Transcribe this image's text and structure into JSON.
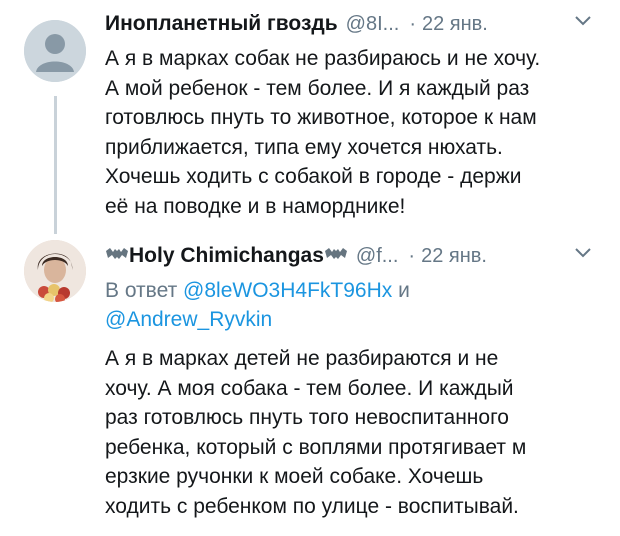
{
  "tweet1": {
    "author_name": "Инопланетный гвоздь",
    "handle": "@8I...",
    "dot": "·",
    "date": "22 янв.",
    "lines": [
      "А я в марках собак не разбираюсь и не хочу.",
      "А мой ребенок - тем более. И я каждый раз",
      "готовлюсь пнуть то животное, которое к нам",
      "приближается, типа ему хочется нюхать.",
      "Хочешь ходить с собакой в городе - держи",
      "её на поводке и в наморднике!"
    ]
  },
  "tweet2": {
    "author_name": "Holy Chimichangas",
    "handle": "@f...",
    "dot": "·",
    "date": "22 янв.",
    "reply_prefix": "В ответ",
    "reply_mention_1": "@8leWO3H4FkT96Hx",
    "reply_conj": "и",
    "reply_mention_2": "@Andrew_Ryvkin",
    "lines": [
      "А я в марках детей не разбираются и не",
      "хочу. А моя собака - тем более. И каждый",
      "раз готовлюсь пнуть того невоспитанного",
      "ребенка, который с воплями протягивает м",
      "ерзкие ручонки к моей собаке. Хочешь",
      "ходить с ребенком по улице - воспитывай."
    ]
  },
  "icons": {
    "menu": "chevron-down-icon",
    "name_decoration": "bat-emoji-icon",
    "default_avatar": "default-profile-avatar-icon"
  },
  "colors": {
    "secondary_text": "#657786",
    "link": "#1b95e0",
    "thread_line": "#c9d2d9"
  }
}
